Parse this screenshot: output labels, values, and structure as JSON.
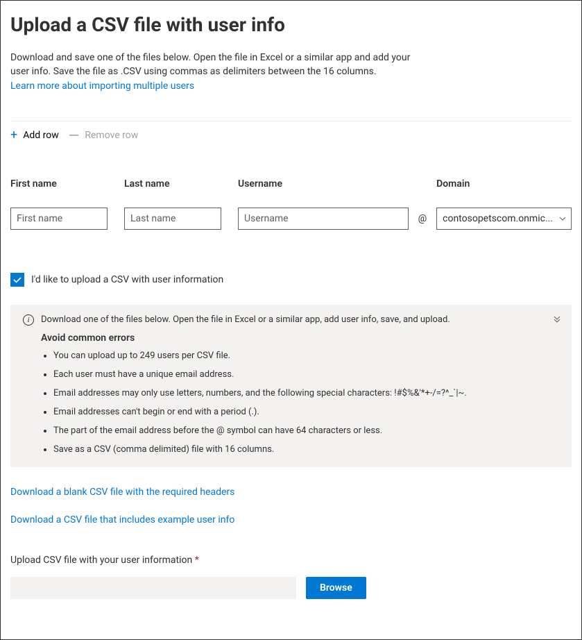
{
  "title": "Upload a CSV file with user info",
  "description": "Download and save one of the files below. Open the file in Excel or a similar app and add your user info. Save the file as .CSV using commas as delimiters between the 16 columns.",
  "learn_more_link": "Learn more about importing multiple users",
  "toolbar": {
    "add_row": "Add row",
    "remove_row": "Remove row"
  },
  "fields": {
    "first_name": {
      "label": "First name",
      "placeholder": "First name"
    },
    "last_name": {
      "label": "Last name",
      "placeholder": "Last name"
    },
    "username": {
      "label": "Username",
      "placeholder": "Username"
    },
    "at_symbol": "@",
    "domain": {
      "label": "Domain",
      "selected": "contosopetscom.onmic..."
    }
  },
  "checkbox": {
    "label": "I'd like to upload a CSV with user information",
    "checked": true
  },
  "info": {
    "lead": "Download one of the files below. Open the file in Excel or a similar app, add user info, save, and upload.",
    "subtitle": "Avoid common errors",
    "errors": [
      "You can upload up to 249 users per CSV file.",
      "Each user must have a unique email address.",
      "Email addresses may only use letters, numbers, and the following special characters: !#$%&'*+-/=?^_`|~.",
      "Email addresses can't begin or end with a period (.).",
      "The part of the email address before the @ symbol can have 64 characters or less.",
      "Save as a CSV (comma delimited) file with 16 columns."
    ]
  },
  "downloads": {
    "blank": "Download a blank CSV file with the required headers",
    "example": "Download a CSV file that includes example user info"
  },
  "upload": {
    "label": "Upload CSV file with your user information",
    "required_marker": "*",
    "browse": "Browse"
  }
}
